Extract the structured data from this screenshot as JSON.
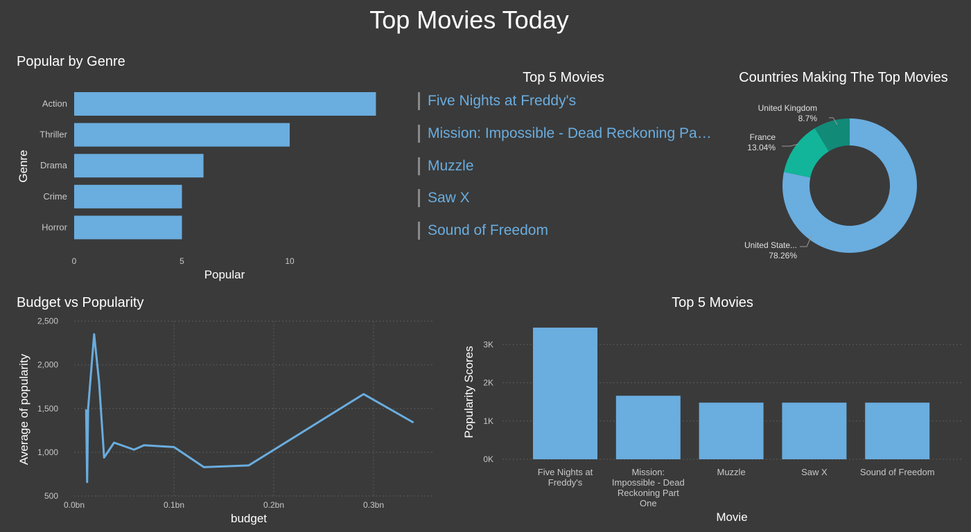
{
  "page": {
    "title": "Top Movies Today"
  },
  "colors": {
    "background": "#3a3a3a",
    "bar": "#6aaddf",
    "line": "#6aaddf",
    "link": "#6aaddf",
    "grid": "#5c5c5c",
    "donut_us": "#6aaddf",
    "donut_fr": "#12b59a",
    "donut_uk": "#128a78"
  },
  "genre_chart": {
    "title": "Popular by Genre",
    "chart_data": {
      "type": "bar",
      "orientation": "horizontal",
      "categories": [
        "Action",
        "Thriller",
        "Drama",
        "Crime",
        "Horror"
      ],
      "values": [
        14,
        10,
        6,
        5,
        5
      ],
      "xlabel": "Popular",
      "ylabel": "Genre",
      "xlim": [
        0,
        14
      ],
      "xticks": [
        "0",
        "5",
        "10"
      ],
      "grid": false
    }
  },
  "top5_list": {
    "title": "Top 5 Movies",
    "items": [
      "Five Nights at Freddy's",
      "Mission: Impossible - Dead Reckoning Part One",
      "Muzzle",
      "Saw X",
      "Sound of Freedom"
    ]
  },
  "countries_chart": {
    "title": "Countries Making The Top Movies",
    "chart_data": {
      "type": "pie",
      "style": "donut",
      "slices": [
        {
          "label": "United State...",
          "value": 78.26,
          "value_label": "78.26%"
        },
        {
          "label": "France",
          "value": 13.04,
          "value_label": "13.04%"
        },
        {
          "label": "United Kingdom",
          "value": 8.7,
          "value_label": "8.7%"
        }
      ]
    }
  },
  "budget_chart": {
    "title": "Budget vs Popularity",
    "chart_data": {
      "type": "line",
      "x": [
        0.012,
        0.013,
        0.014,
        0.02,
        0.025,
        0.03,
        0.04,
        0.06,
        0.07,
        0.1,
        0.13,
        0.175,
        0.29,
        0.34
      ],
      "y": [
        1490,
        660,
        1500,
        2350,
        1800,
        940,
        1110,
        1030,
        1080,
        1060,
        830,
        850,
        1665,
        1340
      ],
      "xlabel": "budget",
      "ylabel": "Average of popularity",
      "xlim": [
        0,
        0.36
      ],
      "ylim": [
        500,
        2500
      ],
      "xticks": [
        "0.0bn",
        "0.1bn",
        "0.2bn",
        "0.3bn"
      ],
      "yticks": [
        "500",
        "1,000",
        "1,500",
        "2,000",
        "2,500"
      ],
      "grid": true
    }
  },
  "movies_chart": {
    "title": "Top 5 Movies",
    "chart_data": {
      "type": "bar",
      "categories": [
        "Five Nights at Freddy's",
        "Mission: Impossible - Dead Reckoning Part One",
        "Muzzle",
        "Saw X",
        "Sound of Freedom"
      ],
      "category_lines": [
        [
          "Five Nights at",
          "Freddy's"
        ],
        [
          "Mission:",
          "Impossible - Dead",
          "Reckoning Part",
          "One"
        ],
        [
          "Muzzle"
        ],
        [
          "Saw X"
        ],
        [
          "Sound of Freedom"
        ]
      ],
      "values": [
        3440,
        1660,
        1480,
        1480,
        1480
      ],
      "xlabel": "Movie",
      "ylabel": "Popularity Scores",
      "ylim": [
        0,
        3600
      ],
      "yticks": [
        "0K",
        "1K",
        "2K",
        "3K"
      ],
      "grid": true
    }
  }
}
